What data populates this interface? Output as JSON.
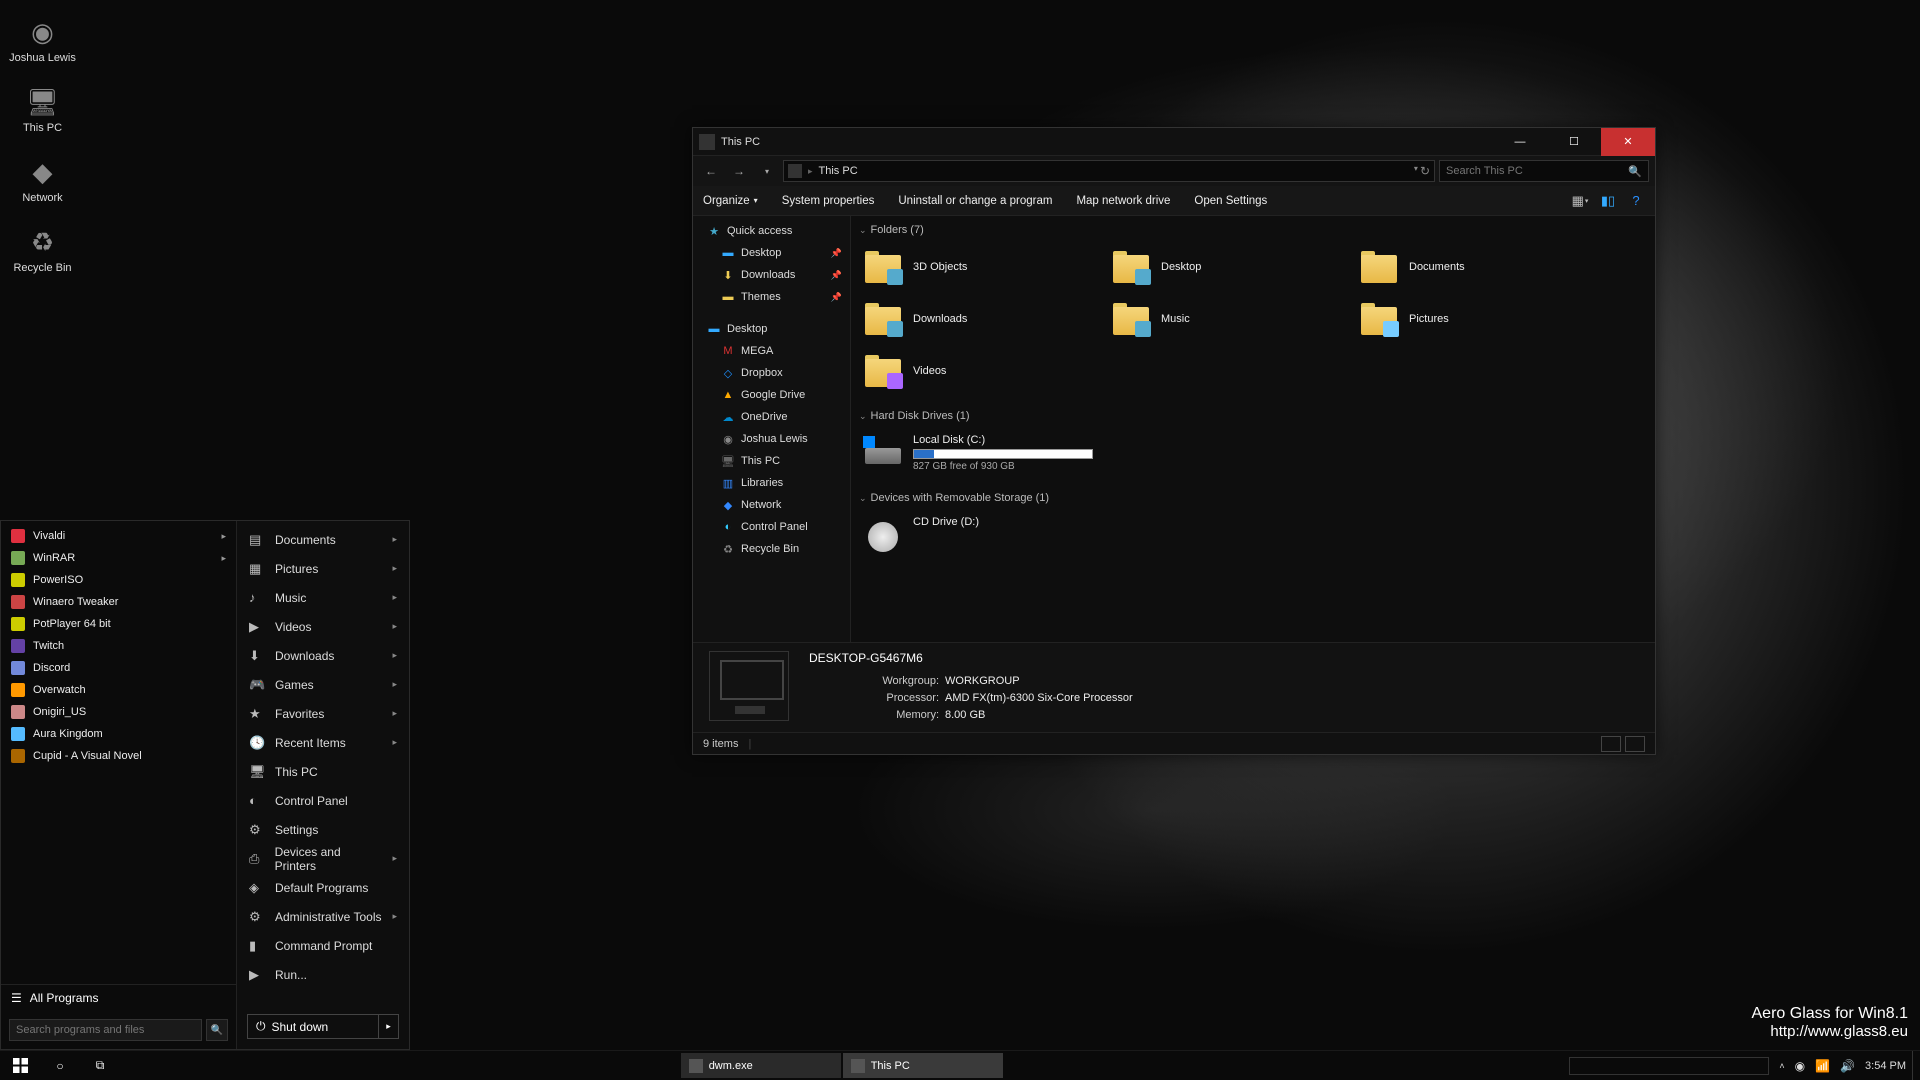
{
  "desktop": {
    "icons": [
      {
        "label": "Joshua Lewis",
        "icon": "user-icon"
      },
      {
        "label": "This PC",
        "icon": "pc-icon"
      },
      {
        "label": "Network",
        "icon": "network-icon"
      },
      {
        "label": "Recycle Bin",
        "icon": "recycle-icon"
      }
    ]
  },
  "watermark": {
    "line1": "Aero Glass for Win8.1",
    "line2": "http://www.glass8.eu"
  },
  "startmenu": {
    "pinned": [
      {
        "label": "Vivaldi",
        "color": "#e03040",
        "hasSub": true
      },
      {
        "label": "WinRAR",
        "color": "#7a5",
        "hasSub": true
      },
      {
        "label": "PowerISO",
        "color": "#cc0"
      },
      {
        "label": "Winaero Tweaker",
        "color": "#c44"
      },
      {
        "label": "PotPlayer 64 bit",
        "color": "#cc0"
      },
      {
        "label": "Twitch",
        "color": "#6441a5"
      },
      {
        "label": "Discord",
        "color": "#7289da"
      },
      {
        "label": "Overwatch",
        "color": "#f90"
      },
      {
        "label": "Onigiri_US",
        "color": "#c88"
      },
      {
        "label": "Aura Kingdom",
        "color": "#5bf"
      },
      {
        "label": "Cupid - A Visual Novel",
        "color": "#a60"
      }
    ],
    "allPrograms": "All Programs",
    "searchPlaceholder": "Search programs and files",
    "right": [
      {
        "label": "Documents",
        "icon": "doc-icon",
        "hasSub": true
      },
      {
        "label": "Pictures",
        "icon": "pic-icon",
        "hasSub": true
      },
      {
        "label": "Music",
        "icon": "music-icon",
        "hasSub": true
      },
      {
        "label": "Videos",
        "icon": "video-icon",
        "hasSub": true
      },
      {
        "label": "Downloads",
        "icon": "download-icon",
        "hasSub": true
      },
      {
        "label": "Games",
        "icon": "game-icon",
        "hasSub": true
      },
      {
        "label": "Favorites",
        "icon": "star-icon",
        "hasSub": true
      },
      {
        "label": "Recent Items",
        "icon": "recent-icon",
        "hasSub": true
      },
      {
        "label": "This PC",
        "icon": "pc-icon"
      },
      {
        "label": "Control Panel",
        "icon": "cp-icon"
      },
      {
        "label": "Settings",
        "icon": "gear-icon"
      },
      {
        "label": "Devices and Printers",
        "icon": "printer-icon",
        "hasSub": true
      },
      {
        "label": "Default Programs",
        "icon": "defprog-icon"
      },
      {
        "label": "Administrative Tools",
        "icon": "admin-icon",
        "hasSub": true
      },
      {
        "label": "Command Prompt",
        "icon": "cmd-icon"
      },
      {
        "label": "Run...",
        "icon": "run-icon"
      }
    ],
    "shutdown": "Shut down"
  },
  "explorer": {
    "title": "This PC",
    "address": "This PC",
    "searchPlaceholder": "Search This PC",
    "commands": {
      "organize": "Organize",
      "sysprop": "System properties",
      "uninstall": "Uninstall or change a program",
      "mapnet": "Map network drive",
      "opensettings": "Open Settings"
    },
    "sidebar": [
      {
        "label": "Quick access",
        "icon": "star-icon",
        "color": "#4ac"
      },
      {
        "label": "Desktop",
        "icon": "desktop-icon",
        "indent": true,
        "color": "#3af",
        "pin": true
      },
      {
        "label": "Downloads",
        "icon": "download-icon",
        "indent": true,
        "color": "#ec5",
        "pin": true
      },
      {
        "label": "Themes",
        "icon": "folder-icon",
        "indent": true,
        "color": "#ec5",
        "pin": true
      },
      {
        "sep": true
      },
      {
        "label": "Desktop",
        "icon": "desktop-icon",
        "color": "#3af"
      },
      {
        "label": "MEGA",
        "icon": "mega-icon",
        "indent": true,
        "color": "#d33"
      },
      {
        "label": "Dropbox",
        "icon": "dropbox-icon",
        "indent": true,
        "color": "#1e90ff"
      },
      {
        "label": "Google Drive",
        "icon": "gdrive-icon",
        "indent": true,
        "color": "#fa0"
      },
      {
        "label": "OneDrive",
        "icon": "onedrive-icon",
        "indent": true,
        "color": "#08c"
      },
      {
        "label": "Joshua Lewis",
        "icon": "user-icon",
        "indent": true,
        "color": "#888"
      },
      {
        "label": "This PC",
        "icon": "pc-icon",
        "indent": true,
        "color": "#666"
      },
      {
        "label": "Libraries",
        "icon": "lib-icon",
        "indent": true,
        "color": "#38f"
      },
      {
        "label": "Network",
        "icon": "network-icon",
        "indent": true,
        "color": "#38f"
      },
      {
        "label": "Control Panel",
        "icon": "cp-icon",
        "indent": true,
        "color": "#3cf"
      },
      {
        "label": "Recycle Bin",
        "icon": "recycle-icon",
        "indent": true,
        "color": "#888"
      }
    ],
    "groups": {
      "foldersHeader": "Folders (7)",
      "folders": [
        {
          "label": "3D Objects",
          "tint": "#5ac"
        },
        {
          "label": "Desktop",
          "tint": "#5ac"
        },
        {
          "label": "Documents",
          "tint": ""
        },
        {
          "label": "Downloads",
          "tint": "#5ac"
        },
        {
          "label": "Music",
          "tint": "#5ac"
        },
        {
          "label": "Pictures",
          "tint": "#7cf"
        },
        {
          "label": "Videos",
          "tint": "#a6f"
        }
      ],
      "drivesHeader": "Hard Disk Drives (1)",
      "drive": {
        "name": "Local Disk (C:)",
        "free": "827 GB free of 930 GB",
        "fillPct": 11
      },
      "removableHeader": "Devices with Removable Storage (1)",
      "cdDrive": {
        "name": "CD Drive (D:)"
      }
    },
    "details": {
      "computerName": "DESKTOP-G5467M6",
      "rows": [
        {
          "k": "Workgroup:",
          "v": "WORKGROUP"
        },
        {
          "k": "Processor:",
          "v": "AMD FX(tm)-6300 Six-Core Processor"
        },
        {
          "k": "Memory:",
          "v": "8.00 GB"
        }
      ]
    },
    "status": "9 items"
  },
  "taskbar": {
    "tasks": [
      {
        "label": "dwm.exe",
        "active": false
      },
      {
        "label": "This PC",
        "active": true
      }
    ],
    "time": "3:54 PM"
  }
}
